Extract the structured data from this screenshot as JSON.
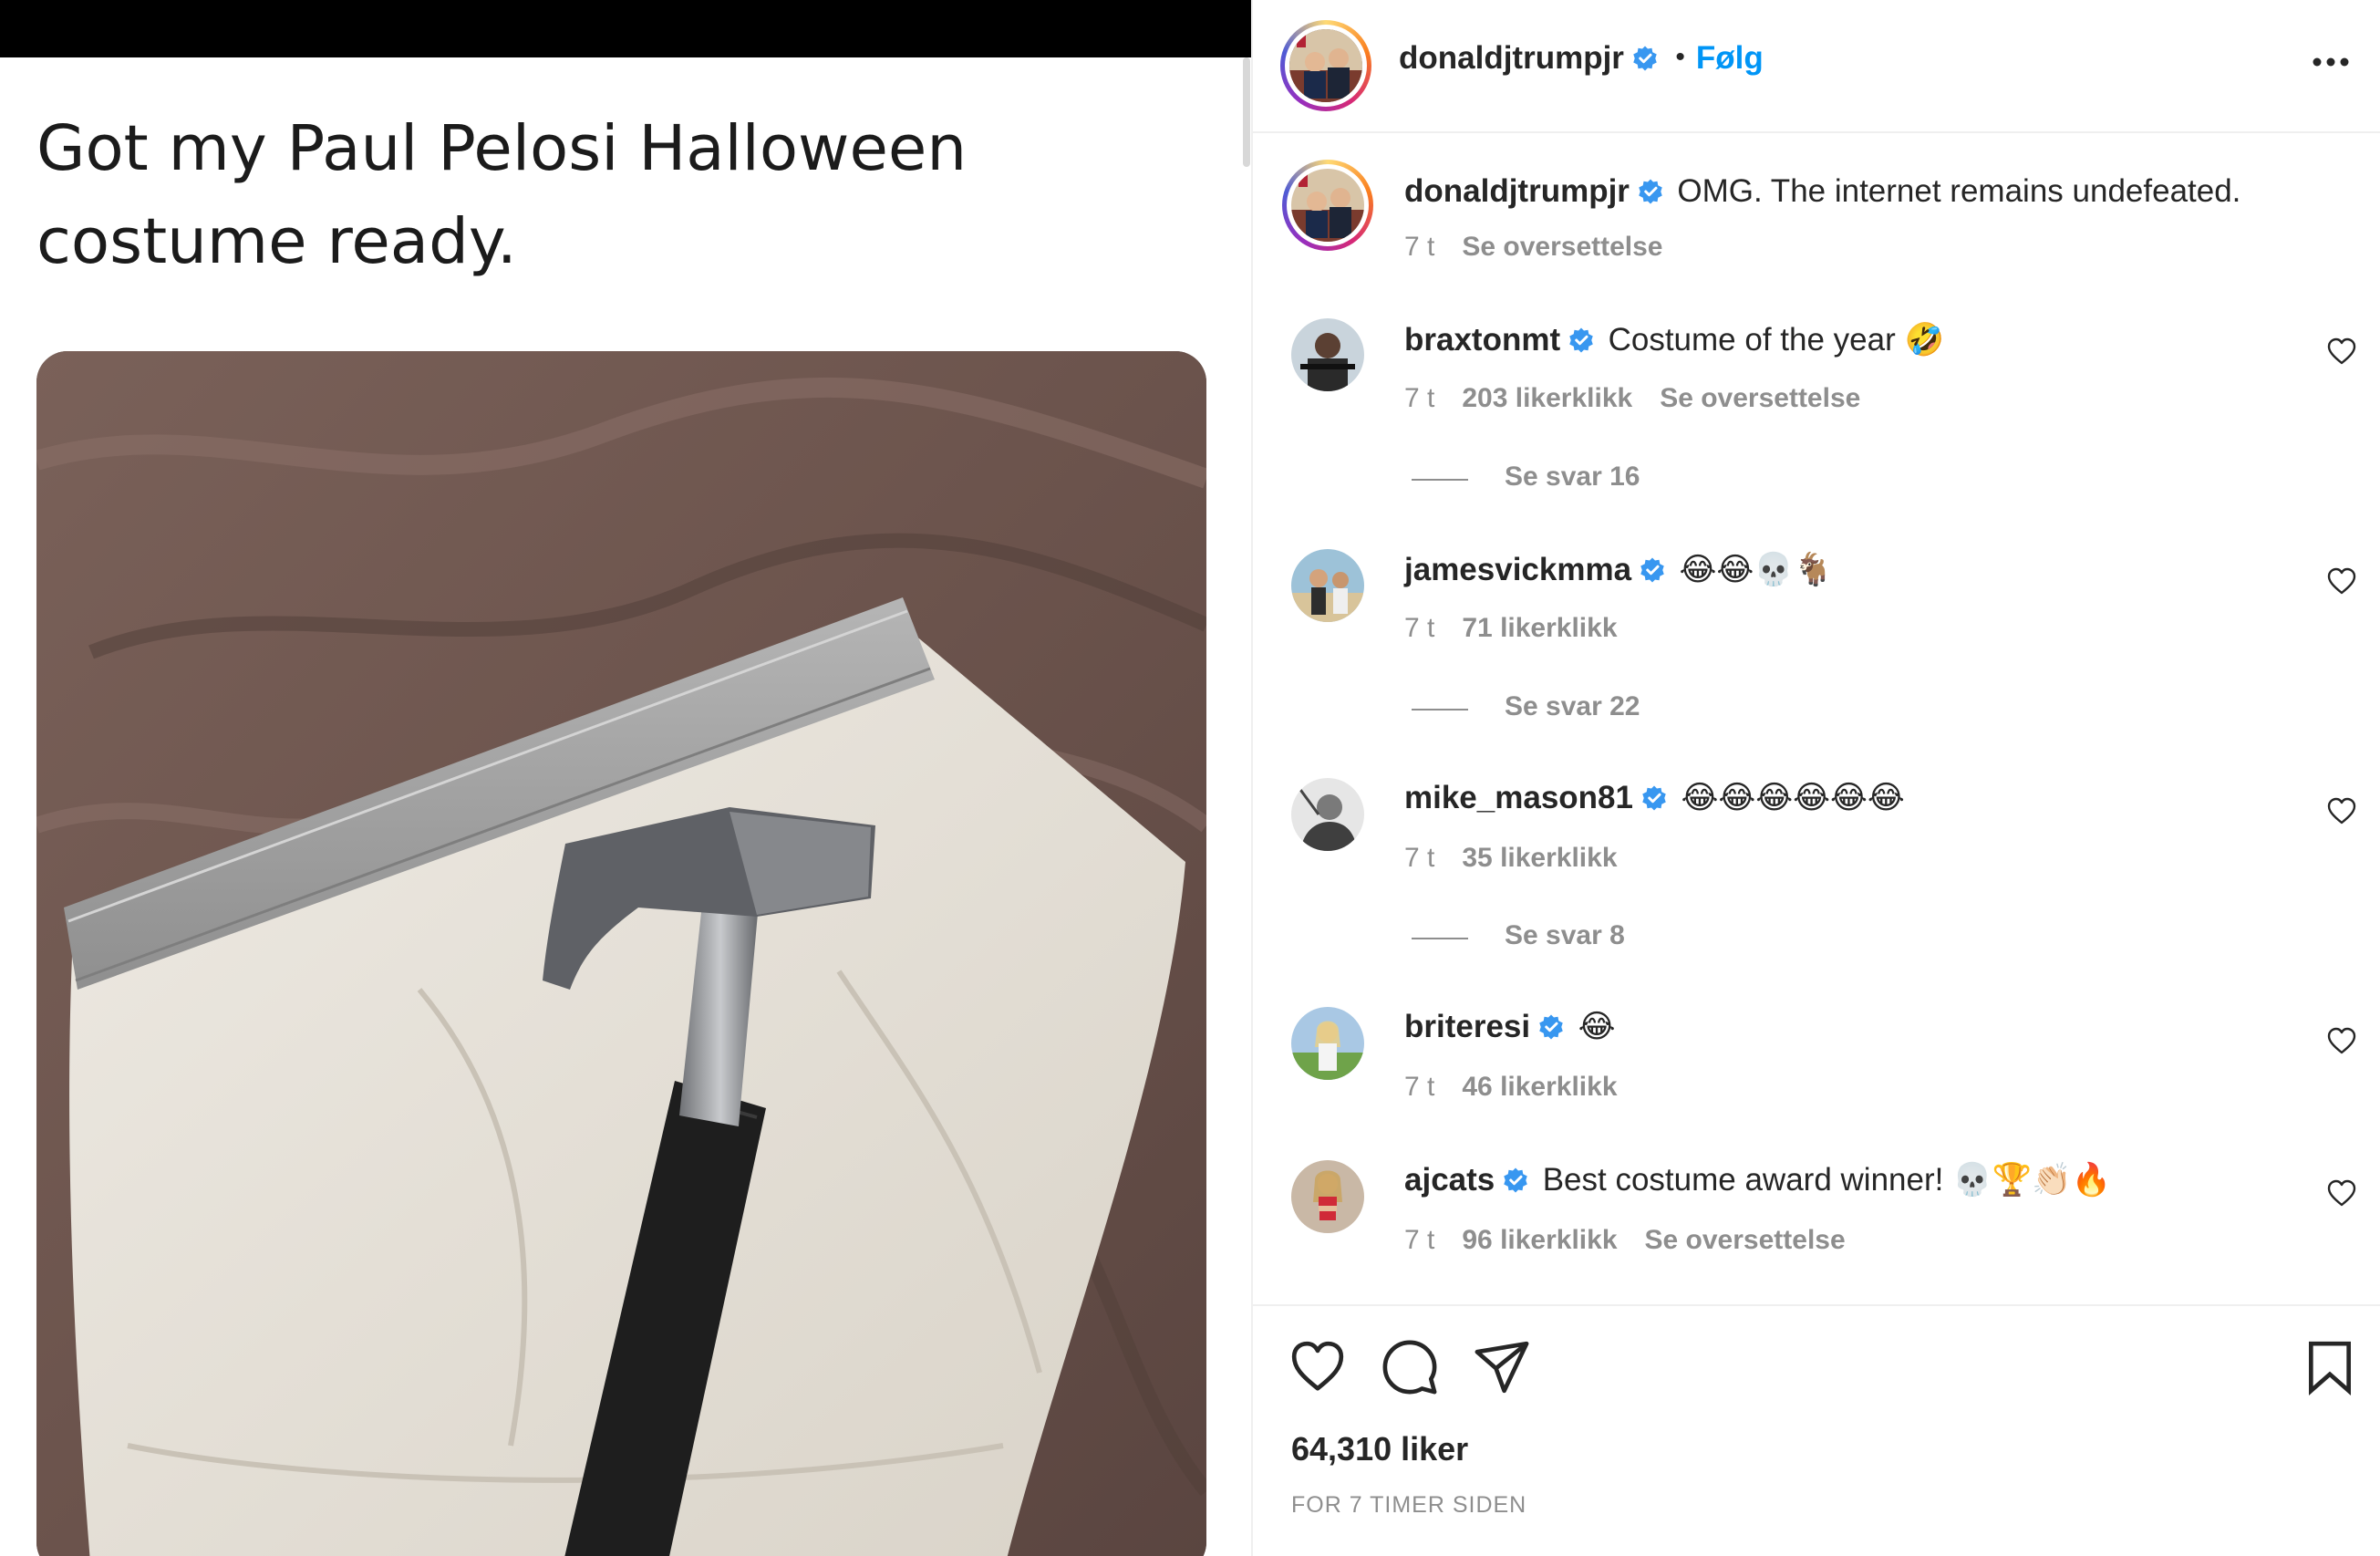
{
  "post": {
    "tweet_text_line1": "Got my Paul Pelosi Halloween",
    "tweet_text_line2": "costume ready.",
    "photo_icon": "underwear-and-hammer-photo"
  },
  "header": {
    "username": "donaldjtrumpjr",
    "separator": "•",
    "follow_label": "Følg",
    "more_icon": "more-options-icon"
  },
  "caption": {
    "username": "donaldjtrumpjr",
    "text": "OMG. The internet remains undefeated.",
    "time": "7 t",
    "translate_label": "Se oversettelse"
  },
  "comments": [
    {
      "username": "braxtonmt",
      "text": "Costume of the year 🤣",
      "time": "7 t",
      "likes": "203 likerklikk",
      "translate_label": "Se oversettelse",
      "replies": "Se svar 16"
    },
    {
      "username": "jamesvickmma",
      "text": "😂😂💀🐐",
      "time": "7 t",
      "likes": "71 likerklikk",
      "translate_label": "",
      "replies": "Se svar 22"
    },
    {
      "username": "mike_mason81",
      "text": "😂😂😂😂😂😂",
      "time": "7 t",
      "likes": "35 likerklikk",
      "translate_label": "",
      "replies": "Se svar 8"
    },
    {
      "username": "briteresi",
      "text": "😂",
      "time": "7 t",
      "likes": "46 likerklikk",
      "translate_label": "",
      "replies": ""
    },
    {
      "username": "ajcats",
      "text": "Best costume award winner! 💀🏆👏🏻🔥",
      "time": "7 t",
      "likes": "96 likerklikk",
      "translate_label": "Se oversettelse",
      "replies": ""
    }
  ],
  "footer": {
    "likes_count": "64,310 liker",
    "time_ago": "FOR 7 TIMER SIDEN"
  },
  "colors": {
    "link_blue": "#0095f6",
    "verified_blue": "#3897f0",
    "muted_gray": "#8e8e8e",
    "text_dark": "#262626"
  }
}
